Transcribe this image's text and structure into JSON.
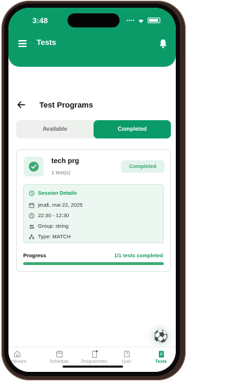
{
  "status_bar": {
    "time": "3:48"
  },
  "header": {
    "title": "Tests"
  },
  "page": {
    "title": "Test Programs"
  },
  "tabs": [
    {
      "label": "Available",
      "active": false
    },
    {
      "label": "Completed",
      "active": true
    }
  ],
  "card": {
    "title": "tech prg",
    "subtitle": "1 test(s)",
    "status": "Completed",
    "session": {
      "heading": "Session Details",
      "date": "jeudi, mai 22, 2025",
      "time": "22:30 - 12:30",
      "group": "Group: string",
      "type": "Type: MATCH"
    },
    "progress": {
      "label": "Progress",
      "text": "1/1 tests completed",
      "fraction": 1.0
    }
  },
  "bottom_nav": [
    {
      "label": "ashboard",
      "icon": "home-icon",
      "active": false
    },
    {
      "label": "Schedule",
      "icon": "calendar-icon",
      "active": false
    },
    {
      "label": "Programmes",
      "icon": "programmes-icon",
      "active": false
    },
    {
      "label": "Quiz",
      "icon": "quiz-icon",
      "active": false
    },
    {
      "label": "Tests",
      "icon": "tests-icon",
      "active": true
    }
  ],
  "colors": {
    "brand": "#0b9b68",
    "accent": "#3daa73",
    "badge_bg": "#e3f4ec",
    "session_bg": "#ecf7f1"
  }
}
